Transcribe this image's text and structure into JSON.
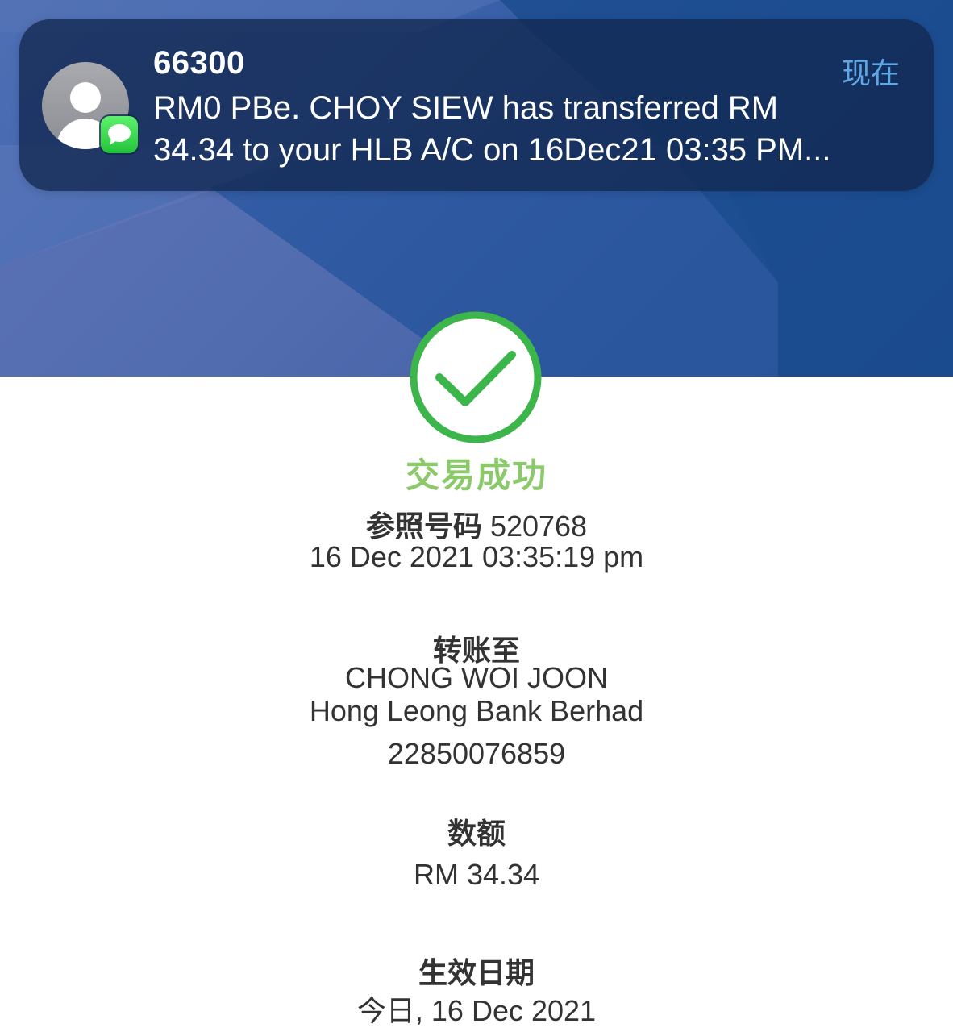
{
  "notification": {
    "sender": "66300",
    "time": "现在",
    "body_line1": "RM0 PBe. CHOY SIEW has transferred RM",
    "body_line2": "34.34 to your HLB A/C on 16Dec21 03:35 PM..."
  },
  "result": {
    "status": "交易成功",
    "reference_label": "参照号码",
    "reference_number": "520768",
    "datetime": "16 Dec 2021 03:35:19 pm"
  },
  "transfer_to": {
    "label": "转账至",
    "name": "CHONG WOI JOON",
    "bank": "Hong Leong Bank Berhad",
    "account": "22850076859"
  },
  "amount": {
    "label": "数额",
    "value": "RM 34.34"
  },
  "effective_date": {
    "label": "生效日期",
    "value": "今日, 16 Dec 2021"
  },
  "colors": {
    "success_green": "#3cb54a",
    "success_text": "#8cc96b",
    "notification_time": "#5da8e6",
    "header_blue": "#1f4f95"
  }
}
